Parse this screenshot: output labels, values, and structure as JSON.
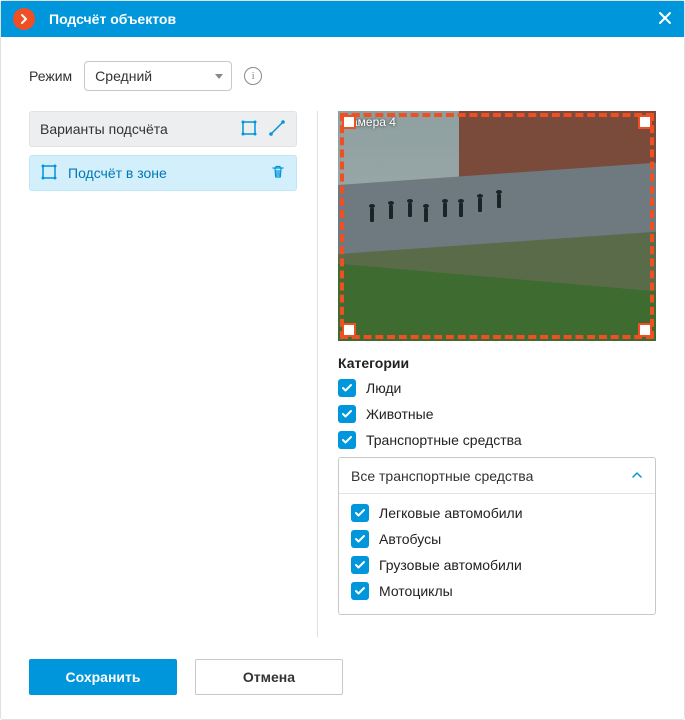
{
  "header": {
    "title": "Подсчёт объектов"
  },
  "mode": {
    "label": "Режим",
    "value": "Средний"
  },
  "variants": {
    "header": "Варианты подсчёта",
    "items": [
      {
        "label": "Подсчёт в зоне"
      }
    ]
  },
  "camera": {
    "label": "Камера 4"
  },
  "categories": {
    "title": "Категории",
    "items": [
      {
        "label": "Люди",
        "checked": true
      },
      {
        "label": "Животные",
        "checked": true
      },
      {
        "label": "Транспортные средства",
        "checked": true
      }
    ]
  },
  "vehicles": {
    "selected": "Все транспортные средства",
    "options": [
      {
        "label": "Легковые автомобили",
        "checked": true
      },
      {
        "label": "Автобусы",
        "checked": true
      },
      {
        "label": "Грузовые автомобили",
        "checked": true
      },
      {
        "label": "Мотоциклы",
        "checked": true
      }
    ]
  },
  "footer": {
    "save": "Сохранить",
    "cancel": "Отмена"
  }
}
